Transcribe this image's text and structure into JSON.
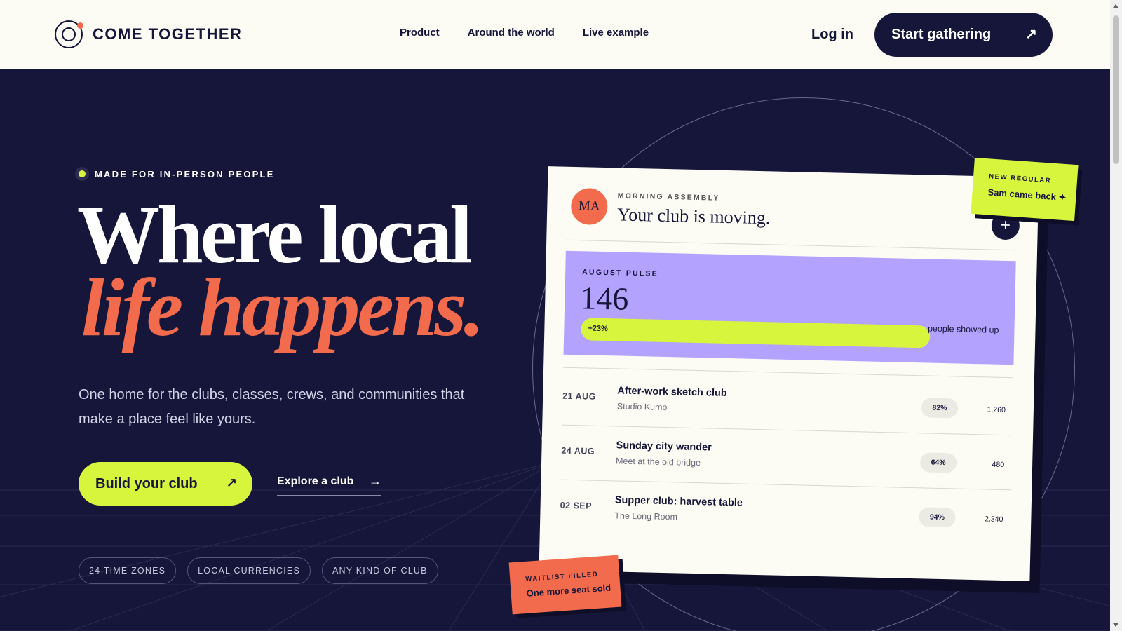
{
  "brand": {
    "name": "COME TOGETHER"
  },
  "nav": {
    "items": [
      {
        "label": "Product"
      },
      {
        "label": "Around the world"
      },
      {
        "label": "Live example"
      }
    ],
    "login_label": "Log in",
    "cta_label": "Start gathering",
    "cta_icon": "arrow-up-right-icon"
  },
  "hero": {
    "eyebrow": "MADE FOR IN-PERSON PEOPLE",
    "title_line1": "Where local",
    "title_line2": "life happens.",
    "lede": "One home for the clubs, classes, crews, and communities that make a place feel like yours.",
    "primary_label": "Build your club",
    "primary_icon": "arrow-up-right-icon",
    "secondary_label": "Explore a club",
    "secondary_icon": "arrow-right-icon",
    "chips": [
      {
        "label": "24 TIME ZONES"
      },
      {
        "label": "LOCAL CURRENCIES"
      },
      {
        "label": "ANY KIND OF CLUB"
      }
    ]
  },
  "card": {
    "avatar": "MA",
    "eyebrow": "MORNING ASSEMBLY",
    "title": "Your club is moving.",
    "plus_label": "+",
    "pulse": {
      "eyebrow": "AUGUST PULSE",
      "value": "146",
      "change": "+23%",
      "progress": 1.0,
      "label": "people showed up"
    },
    "events": [
      {
        "date": "21 AUG",
        "name": "After-work sketch club",
        "place": "Studio Kumo",
        "pct": "82%",
        "count": "1,260"
      },
      {
        "date": "24 AUG",
        "name": "Sunday city wander",
        "place": "Meet at the old bridge",
        "pct": "64%",
        "count": "480"
      },
      {
        "date": "02 SEP",
        "name": "Supper club: harvest table",
        "place": "The Long Room",
        "pct": "94%",
        "count": "2,340"
      }
    ]
  },
  "stickers": {
    "green": {
      "eyebrow": "NEW REGULAR",
      "message": "Sam came back ✦"
    },
    "orange": {
      "eyebrow": "WAITLIST FILLED",
      "message": "One more seat sold"
    }
  },
  "colors": {
    "navy": "#16163a",
    "cream": "#fcfbf4",
    "lime": "#d8f53e",
    "coral": "#f26b4c",
    "lavender": "#b4a2ff"
  }
}
